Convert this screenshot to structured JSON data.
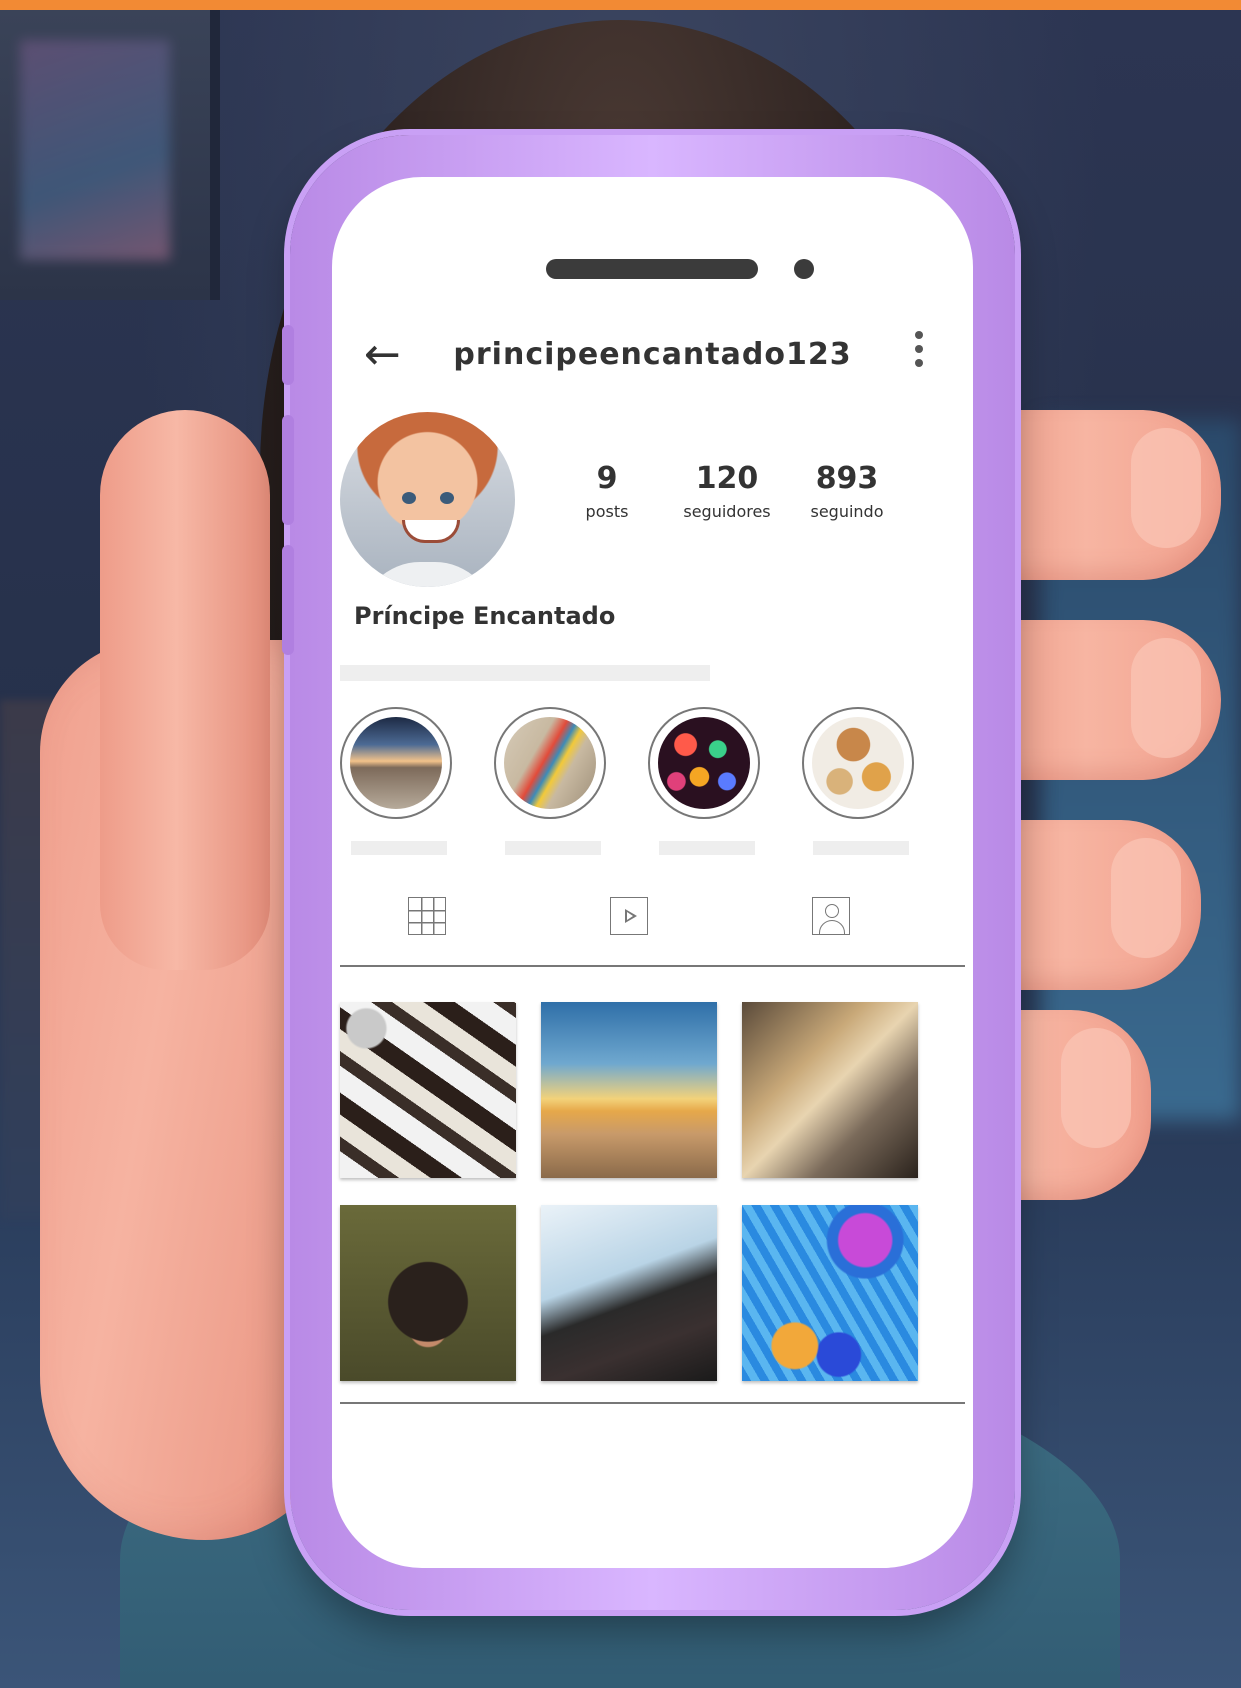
{
  "profile": {
    "username": "principeencantado123",
    "display_name": "Príncipe Encantado",
    "stats": [
      {
        "value": "9",
        "label": "posts"
      },
      {
        "value": "120",
        "label": "seguidores"
      },
      {
        "value": "893",
        "label": "seguindo"
      }
    ]
  },
  "icons": {
    "back": "←",
    "more": "kebab-menu-icon",
    "tabs": [
      "grid-icon",
      "reels-icon",
      "tagged-icon"
    ]
  },
  "highlights": [
    {
      "subject": "airplane-window-sky"
    },
    {
      "subject": "skateboard"
    },
    {
      "subject": "bokeh-lights"
    },
    {
      "subject": "food-tray"
    }
  ],
  "posts": [
    {
      "subject": "polaroid-party-photos"
    },
    {
      "subject": "palm-beach-sunset"
    },
    {
      "subject": "champagne-toast"
    },
    {
      "subject": "smiling-dog"
    },
    {
      "subject": "skateboard-jump"
    },
    {
      "subject": "pool-floats"
    }
  ],
  "colors": {
    "accent_bar": "#f28a34",
    "phone_case": "#c9a0f5",
    "screen": "#ffffff",
    "text": "#333333"
  }
}
